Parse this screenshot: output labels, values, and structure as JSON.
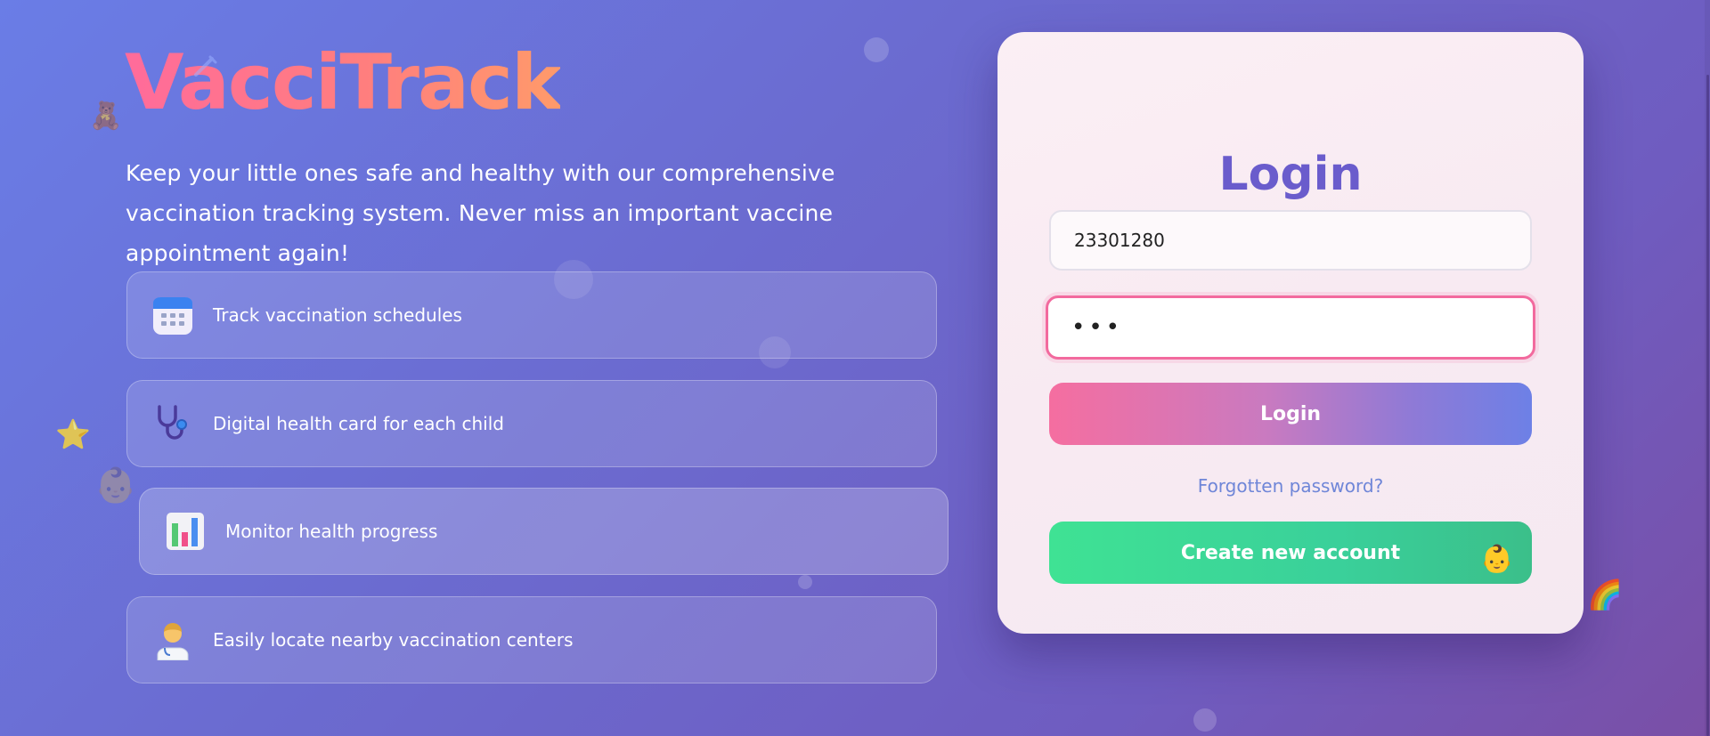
{
  "brand": {
    "name": "VacciTrack",
    "tagline": "Keep your little ones safe and healthy with our comprehensive vaccination tracking system. Never miss an important vaccine appointment again!"
  },
  "features": [
    {
      "label": "Track vaccination schedules",
      "icon": "calendar-icon"
    },
    {
      "label": "Digital health card for each child",
      "icon": "stethoscope-icon"
    },
    {
      "label": "Monitor health progress",
      "icon": "bar-chart-icon"
    },
    {
      "label": "Easily locate nearby vaccination centers",
      "icon": "health-worker-icon"
    }
  ],
  "login": {
    "title": "Login",
    "username_value": "23301280",
    "password_value": "•••",
    "submit_label": "Login",
    "forgot_label": "Forgotten password?",
    "create_label": "Create new account"
  },
  "decorations": {
    "bear": "🧸",
    "star": "⭐",
    "baby_face": "👶",
    "rainbow": "🌈",
    "baby_emoji": "👶"
  },
  "colors": {
    "brand_gradient_start": "#ff6b9b",
    "brand_gradient_end": "#ff9a6a",
    "title_color": "#6a5ccc",
    "focus_border": "#f26a9e",
    "login_gradient_start": "#f56ea0",
    "login_gradient_end": "#6d80e6",
    "create_green": "#3fe294",
    "link_color": "#6f86d8"
  }
}
